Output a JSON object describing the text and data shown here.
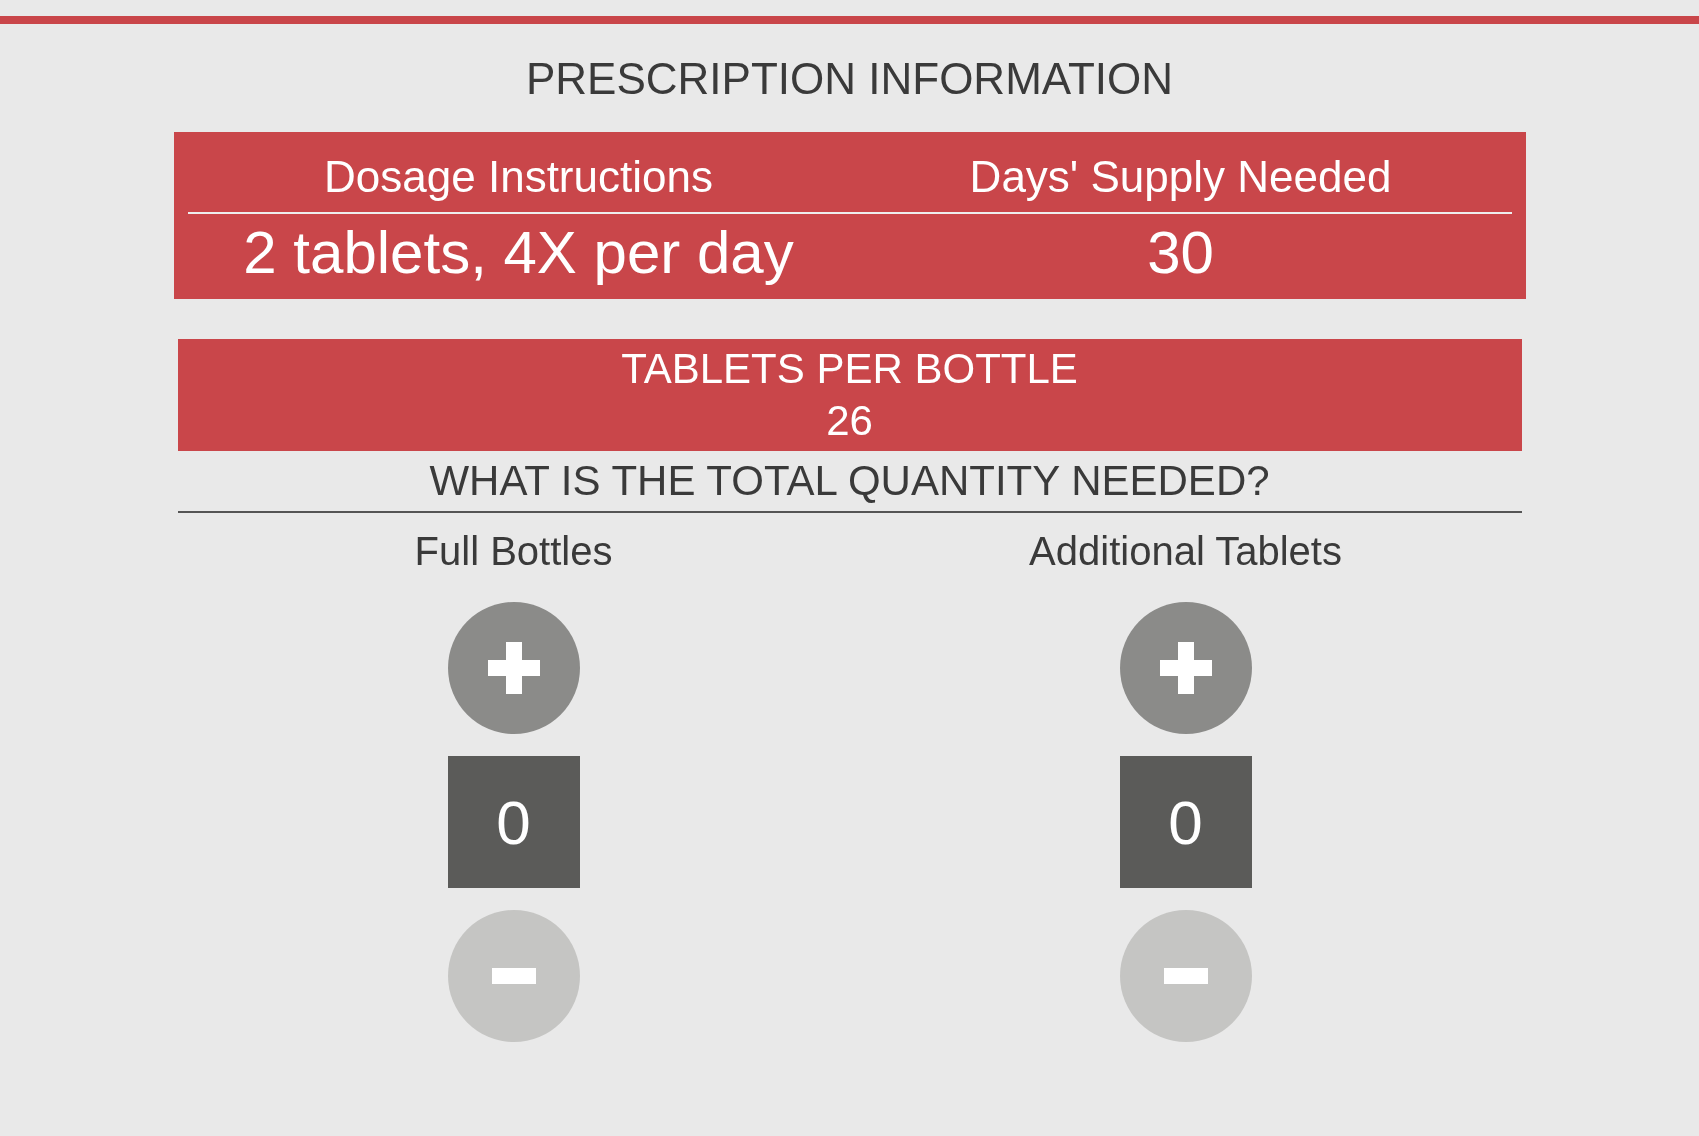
{
  "header": {
    "title": "PRESCRIPTION INFORMATION"
  },
  "prescription_table": {
    "columns": [
      "Dosage Instructions",
      "Days' Supply Needed"
    ],
    "row": [
      "2 tablets, 4X per day",
      "30"
    ]
  },
  "tablets_per_bottle": {
    "label": "TABLETS PER BOTTLE",
    "value": "26"
  },
  "question": "WHAT IS THE TOTAL QUANTITY NEEDED?",
  "counters": [
    {
      "label": "Full Bottles",
      "value": "0",
      "increase_disabled": false,
      "decrease_disabled": true
    },
    {
      "label": "Additional Tablets",
      "value": "0",
      "increase_disabled": false,
      "decrease_disabled": true
    }
  ]
}
